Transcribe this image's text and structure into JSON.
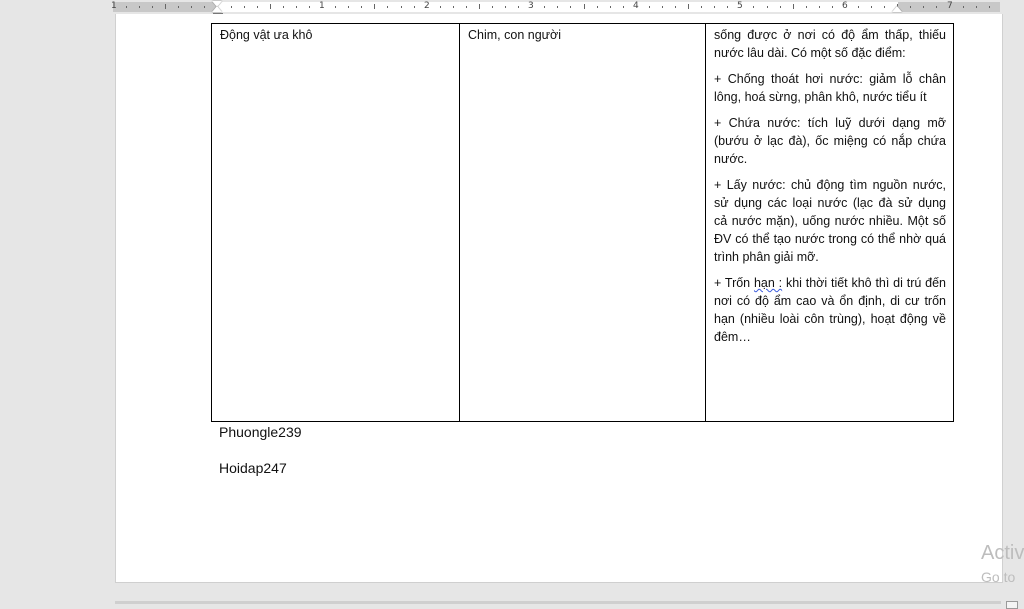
{
  "ruler": {
    "numbers": [
      "1",
      "1",
      "2",
      "3",
      "4",
      "5",
      "6",
      "7"
    ]
  },
  "table": {
    "rows": [
      {
        "col1": "Động vật ưa khô",
        "col2": "Chim, con người",
        "col3": {
          "p1": "sống được ở nơi có độ ẩm thấp, thiếu nước lâu dài. Có một số đặc điểm:",
          "p2": "+ Chống thoát hơi nước: giảm lỗ chân lông, hoá sừng, phân khô, nước tiểu ít",
          "p3": "+ Chứa nước: tích luỹ dưới dạng mỡ (bướu ở lạc đà), ốc miệng có nắp chứa nước.",
          "p4": "+ Lấy nước: chủ động tìm nguồn nước, sử dụng các loại nước (lạc đà sử dụng cả nước mặn), uống nước nhiều. Một số ĐV có thể tạo nước trong có thể nhờ quá trình phân giải mỡ.",
          "p5_prefix": "+ Trốn ",
          "p5_squiggle": "hạn :",
          "p5_rest": " khi thời tiết khô thì di trú đến nơi có độ ẩm cao và ổn định, di cư trốn hạn (nhiều loài côn trùng), hoạt động về đêm…"
        }
      }
    ]
  },
  "below": {
    "line1": "Phuongle239",
    "line2": "Hoidap247"
  },
  "watermark": {
    "line1": "Activ",
    "line2": "Go to"
  }
}
